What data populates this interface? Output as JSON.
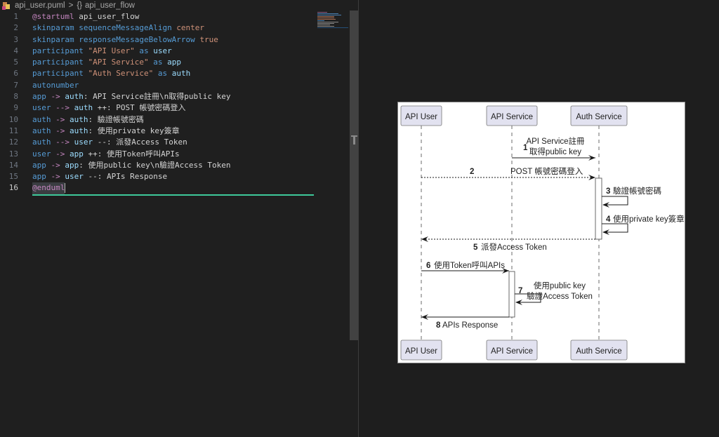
{
  "breadcrumb": {
    "file_icon": "puml-file-icon",
    "file_name": "api_user.puml",
    "separator": ">",
    "symbol_icon": "{}",
    "symbol_name": "api_user_flow"
  },
  "editor": {
    "active_line": 16,
    "lines": [
      {
        "n": "1",
        "tokens": [
          {
            "t": "@startuml",
            "c": "dir"
          },
          {
            "t": " api_user_flow",
            "c": "txt"
          }
        ]
      },
      {
        "n": "2",
        "tokens": [
          {
            "t": "skinparam",
            "c": "kw"
          },
          {
            "t": " ",
            "c": "txt"
          },
          {
            "t": "sequenceMessageAlign",
            "c": "kw"
          },
          {
            "t": " ",
            "c": "txt"
          },
          {
            "t": "center",
            "c": "str"
          }
        ]
      },
      {
        "n": "3",
        "tokens": [
          {
            "t": "skinparam",
            "c": "kw"
          },
          {
            "t": " ",
            "c": "txt"
          },
          {
            "t": "responseMessageBelowArrow",
            "c": "kw"
          },
          {
            "t": " ",
            "c": "txt"
          },
          {
            "t": "true",
            "c": "str"
          }
        ]
      },
      {
        "n": "4",
        "tokens": [
          {
            "t": "participant",
            "c": "kw"
          },
          {
            "t": " ",
            "c": "txt"
          },
          {
            "t": "\"API User\"",
            "c": "str"
          },
          {
            "t": " ",
            "c": "txt"
          },
          {
            "t": "as",
            "c": "kw"
          },
          {
            "t": " ",
            "c": "txt"
          },
          {
            "t": "user",
            "c": "id"
          }
        ]
      },
      {
        "n": "5",
        "tokens": [
          {
            "t": "participant",
            "c": "kw"
          },
          {
            "t": " ",
            "c": "txt"
          },
          {
            "t": "\"API Service\"",
            "c": "str"
          },
          {
            "t": " ",
            "c": "txt"
          },
          {
            "t": "as",
            "c": "kw"
          },
          {
            "t": " ",
            "c": "txt"
          },
          {
            "t": "app",
            "c": "id"
          }
        ]
      },
      {
        "n": "6",
        "tokens": [
          {
            "t": "participant",
            "c": "kw"
          },
          {
            "t": " ",
            "c": "txt"
          },
          {
            "t": "\"Auth Service\"",
            "c": "str"
          },
          {
            "t": " ",
            "c": "txt"
          },
          {
            "t": "as",
            "c": "kw"
          },
          {
            "t": " ",
            "c": "txt"
          },
          {
            "t": "auth",
            "c": "id"
          }
        ]
      },
      {
        "n": "7",
        "tokens": [
          {
            "t": "autonumber",
            "c": "kw"
          }
        ]
      },
      {
        "n": "8",
        "tokens": [
          {
            "t": "app",
            "c": "kw"
          },
          {
            "t": " ",
            "c": "txt"
          },
          {
            "t": "->",
            "c": "arr"
          },
          {
            "t": " ",
            "c": "txt"
          },
          {
            "t": "auth",
            "c": "id"
          },
          {
            "t": ": API Service註冊\\n取得public key",
            "c": "txt"
          }
        ]
      },
      {
        "n": "9",
        "tokens": [
          {
            "t": "user",
            "c": "kw"
          },
          {
            "t": " ",
            "c": "txt"
          },
          {
            "t": "-->",
            "c": "arr"
          },
          {
            "t": " ",
            "c": "txt"
          },
          {
            "t": "auth",
            "c": "id"
          },
          {
            "t": " ++: POST 帳號密碼登入",
            "c": "txt"
          }
        ]
      },
      {
        "n": "10",
        "tokens": [
          {
            "t": "auth",
            "c": "kw"
          },
          {
            "t": " ",
            "c": "txt"
          },
          {
            "t": "->",
            "c": "arr"
          },
          {
            "t": " ",
            "c": "txt"
          },
          {
            "t": "auth",
            "c": "id"
          },
          {
            "t": ": 驗證帳號密碼",
            "c": "txt"
          }
        ]
      },
      {
        "n": "11",
        "tokens": [
          {
            "t": "auth",
            "c": "kw"
          },
          {
            "t": " ",
            "c": "txt"
          },
          {
            "t": "->",
            "c": "arr"
          },
          {
            "t": " ",
            "c": "txt"
          },
          {
            "t": "auth",
            "c": "id"
          },
          {
            "t": ": 使用private key簽章",
            "c": "txt"
          }
        ]
      },
      {
        "n": "12",
        "tokens": [
          {
            "t": "auth",
            "c": "kw"
          },
          {
            "t": " ",
            "c": "txt"
          },
          {
            "t": "-->",
            "c": "arr"
          },
          {
            "t": " ",
            "c": "txt"
          },
          {
            "t": "user",
            "c": "id"
          },
          {
            "t": " --: 派發Access Token",
            "c": "txt"
          }
        ]
      },
      {
        "n": "13",
        "tokens": [
          {
            "t": "user",
            "c": "kw"
          },
          {
            "t": " ",
            "c": "txt"
          },
          {
            "t": "->",
            "c": "arr"
          },
          {
            "t": " ",
            "c": "txt"
          },
          {
            "t": "app",
            "c": "id"
          },
          {
            "t": " ++: 使用Token呼叫APIs",
            "c": "txt"
          }
        ]
      },
      {
        "n": "14",
        "tokens": [
          {
            "t": "app",
            "c": "kw"
          },
          {
            "t": " ",
            "c": "txt"
          },
          {
            "t": "->",
            "c": "arr"
          },
          {
            "t": " ",
            "c": "txt"
          },
          {
            "t": "app",
            "c": "id"
          },
          {
            "t": ": 使用public key\\n驗證Access Token",
            "c": "txt"
          }
        ]
      },
      {
        "n": "15",
        "tokens": [
          {
            "t": "app",
            "c": "kw"
          },
          {
            "t": " ",
            "c": "txt"
          },
          {
            "t": "->",
            "c": "arr"
          },
          {
            "t": " ",
            "c": "txt"
          },
          {
            "t": "user",
            "c": "id"
          },
          {
            "t": " --: APIs Response",
            "c": "txt"
          }
        ]
      },
      {
        "n": "16",
        "tokens": [
          {
            "t": "@enduml",
            "c": "dir"
          }
        ]
      }
    ]
  },
  "diagram": {
    "participants": [
      {
        "id": "user",
        "label": "API User"
      },
      {
        "id": "app",
        "label": "API Service"
      },
      {
        "id": "auth",
        "label": "Auth Service"
      }
    ],
    "messages": [
      {
        "num": "1",
        "from": "app",
        "to": "auth",
        "style": "solid",
        "lines": [
          "API Service註冊",
          "取得public key"
        ]
      },
      {
        "num": "2",
        "from": "user",
        "to": "auth",
        "style": "dashed",
        "lines": [
          "POST 帳號密碼登入"
        ]
      },
      {
        "num": "3",
        "from": "auth",
        "to": "auth",
        "style": "solid",
        "lines": [
          "驗證帳號密碼"
        ]
      },
      {
        "num": "4",
        "from": "auth",
        "to": "auth",
        "style": "solid",
        "lines": [
          "使用private key簽章"
        ]
      },
      {
        "num": "5",
        "from": "auth",
        "to": "user",
        "style": "dashed",
        "lines": [
          "派發Access Token"
        ]
      },
      {
        "num": "6",
        "from": "user",
        "to": "app",
        "style": "solid",
        "lines": [
          "使用Token呼叫APIs"
        ]
      },
      {
        "num": "7",
        "from": "app",
        "to": "app",
        "style": "solid",
        "lines": [
          "使用public key",
          "驗證Access Token"
        ]
      },
      {
        "num": "8",
        "from": "app",
        "to": "user",
        "style": "solid",
        "lines": [
          "APIs Response"
        ]
      }
    ],
    "colors": {
      "participant_fill": "#e2e2f0",
      "participant_border": "#181818",
      "line": "#181818",
      "activation_fill": "#ffffff"
    }
  }
}
